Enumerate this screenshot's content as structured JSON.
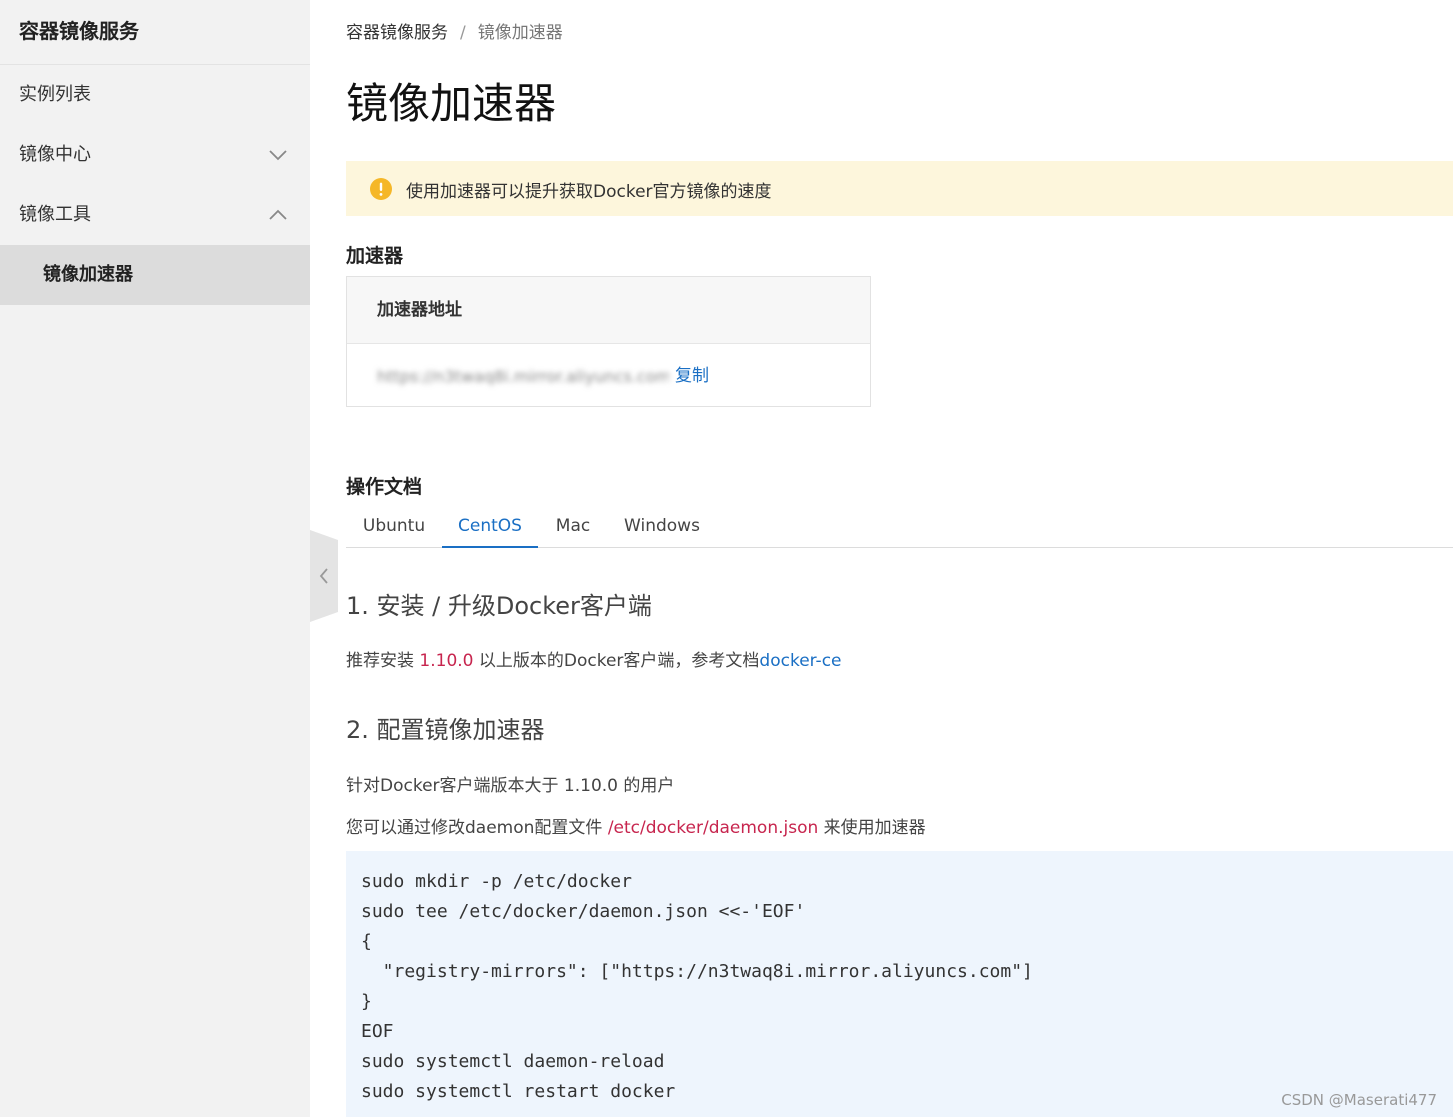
{
  "sidebar": {
    "title": "容器镜像服务",
    "items": [
      {
        "label": "实例列表",
        "chevron": ""
      },
      {
        "label": "镜像中心",
        "chevron": "chevron-down-icon"
      },
      {
        "label": "镜像工具",
        "chevron": "chevron-up-icon"
      }
    ],
    "active_subitem": "镜像加速器"
  },
  "breadcrumb": {
    "root": "容器镜像服务",
    "separator": "/",
    "current": "镜像加速器"
  },
  "page_title": "镜像加速器",
  "notice": {
    "icon": "warning-icon",
    "text": "使用加速器可以提升获取Docker官方镜像的速度",
    "color": "#fdf6dc"
  },
  "accelerator": {
    "section_title": "加速器",
    "table_header": "加速器地址",
    "address": "https://n3twaq8i.mirror.aliyuncs.com",
    "copy_label": "复制"
  },
  "docs": {
    "section_title": "操作文档",
    "tabs": [
      "Ubuntu",
      "CentOS",
      "Mac",
      "Windows"
    ],
    "active_tab": "CentOS",
    "step1": {
      "title": "1. 安装 / 升级Docker客户端",
      "text_before": "推荐安装 ",
      "version": "1.10.0",
      "text_middle": " 以上版本的Docker客户端，参考文档",
      "link": "docker-ce"
    },
    "step2": {
      "title": "2. 配置镜像加速器",
      "line1": "针对Docker客户端版本大于 1.10.0 的用户",
      "line2_before": "您可以通过修改daemon配置文件 ",
      "config_path": "/etc/docker/daemon.json",
      "line2_after": " 来使用加速器"
    },
    "code_lines": [
      "sudo mkdir -p /etc/docker",
      "sudo tee /etc/docker/daemon.json <<-'EOF'",
      "{",
      "  \"registry-mirrors\": [\"https://n3twaq8i.mirror.aliyuncs.com\"]",
      "}",
      "EOF",
      "sudo systemctl daemon-reload",
      "sudo systemctl restart docker"
    ]
  },
  "watermark": "CSDN @Maserati477",
  "colors": {
    "accent": "#1a6fc4",
    "highlight": "#c7254e",
    "warning": "#f5b728",
    "code_bg": "#eef5fd"
  }
}
